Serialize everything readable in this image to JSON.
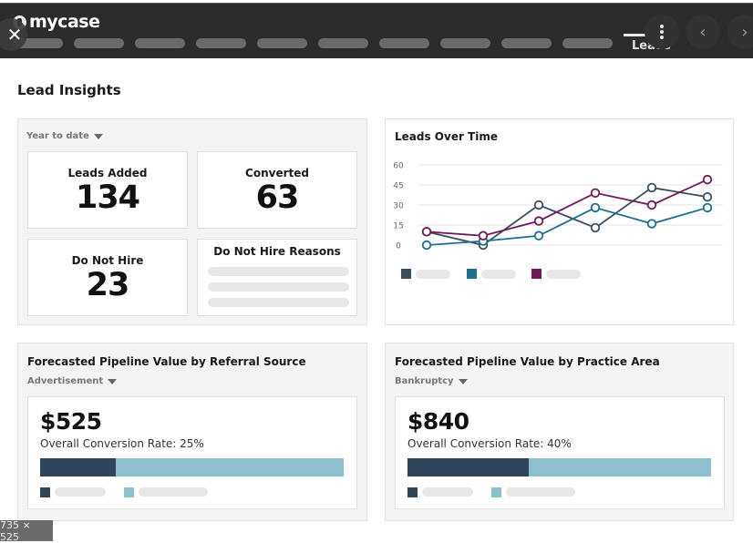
{
  "topbar": {
    "brand": "mycase",
    "close_icon": "close-icon",
    "nav_placeholder_count": 10,
    "active_tab": "Leads",
    "active_tab_progress": 0.45,
    "more_icon": "kebab-icon",
    "prev_icon": "chevron-left-icon",
    "next_icon": "chevron-right-icon",
    "close_glyph": "✕",
    "prev_glyph": "‹",
    "next_glyph": "›"
  },
  "page": {
    "title": "Lead Insights"
  },
  "summary": {
    "range_dropdown": "Year to date",
    "cards": [
      {
        "label": "Leads Added",
        "value": "134"
      },
      {
        "label": "Converted",
        "value": "63"
      },
      {
        "label": "Do Not Hire",
        "value": "23"
      }
    ],
    "reasons_title": "Do Not Hire Reasons"
  },
  "leads_chart": {
    "title": "Leads Over Time"
  },
  "chart_data": {
    "type": "line",
    "title": "Leads Over Time",
    "xlabel": "",
    "ylabel": "",
    "x": [
      1,
      2,
      3,
      4,
      5,
      6
    ],
    "ylim": [
      0,
      60
    ],
    "yticks": [
      0,
      15,
      30,
      45,
      60
    ],
    "ytick_labels": [
      "0",
      "15",
      "30",
      "45",
      "60"
    ],
    "grid": true,
    "legend": "bottom-left",
    "series": [
      {
        "name": "",
        "color": "#3a4d5e",
        "values": [
          10,
          0,
          30,
          13,
          43,
          36
        ]
      },
      {
        "name": "",
        "color": "#1f6f8f",
        "values": [
          0,
          3,
          7,
          28,
          16,
          28
        ]
      },
      {
        "name": "",
        "color": "#6e1b5a",
        "values": [
          10,
          7,
          18,
          39,
          30,
          49
        ]
      }
    ]
  },
  "referral": {
    "title": "Forecasted Pipeline Value by Referral Source",
    "dropdown": "Advertisement",
    "amount": "$525",
    "conversion_text": "Overall Conversion Rate: 25%",
    "conversion_rate": 0.25,
    "colors": {
      "converted": "#2f4659",
      "remaining": "#8dbfcc"
    }
  },
  "practice": {
    "title": "Forecasted Pipeline Value by Practice Area",
    "dropdown": "Bankruptcy",
    "amount": "$840",
    "conversion_text": "Overall Conversion Rate: 40%",
    "conversion_rate": 0.4,
    "colors": {
      "converted": "#2f4659",
      "remaining": "#8dbfcc"
    }
  },
  "overlay": {
    "size_badge": "735 × 525"
  }
}
